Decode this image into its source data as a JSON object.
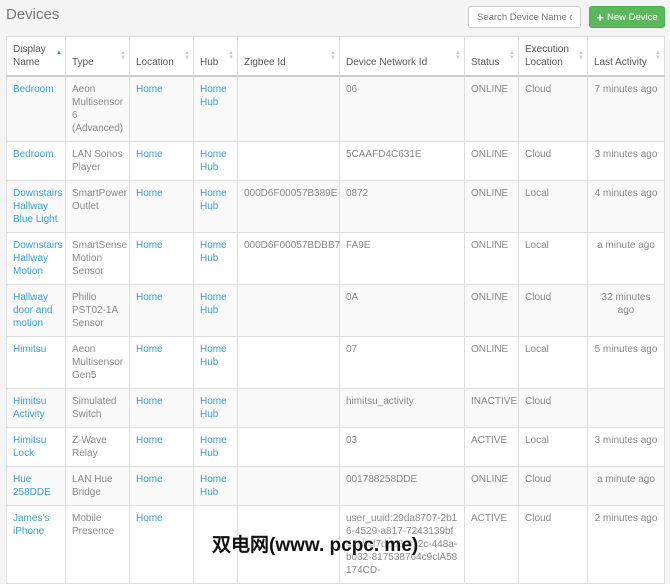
{
  "title": "Devices",
  "search": {
    "placeholder": "Search Device Name or"
  },
  "new_device_label": "New Device",
  "columns": [
    "Display Name",
    "Type",
    "Location",
    "Hub",
    "Zigbee Id",
    "Device Network Id",
    "Status",
    "Execution Location",
    "Last Activity"
  ],
  "rows": [
    [
      "Bedroom",
      "Aeon Multisensor 6 (Advanced)",
      "Home",
      "Home Hub",
      "",
      "06",
      "ONLINE",
      "Cloud",
      "7 minutes ago"
    ],
    [
      "Bedroom",
      "LAN Sonos Player",
      "Home",
      "Home Hub",
      "",
      "5CAAFD4C631E",
      "ONLINE",
      "Cloud",
      "3 minutes ago"
    ],
    [
      "Downstairs Hallway Blue Light",
      "SmartPower Outlet",
      "Home",
      "Home Hub",
      "000D6F00057B389E",
      "0872",
      "ONLINE",
      "Local",
      "4 minutes ago"
    ],
    [
      "Downstairs Hallway Motion",
      "SmartSense Motion Sensor",
      "Home",
      "Home Hub",
      "000D6F00057BDBB7",
      "FA9E",
      "ONLINE",
      "Local",
      "a minute ago"
    ],
    [
      "Hallway door and motion",
      "Philio PST02-1A Sensor",
      "Home",
      "Home Hub",
      "",
      "0A",
      "ONLINE",
      "Cloud",
      "32 minutes ago"
    ],
    [
      "Himitsu",
      "Aeon Multisensor Gen5",
      "Home",
      "Home Hub",
      "",
      "07",
      "ONLINE",
      "Local",
      "5 minutes ago"
    ],
    [
      "Himitsu Activity",
      "Simulated Switch",
      "Home",
      "Home Hub",
      "",
      "himitsu_activity",
      "INACTIVE",
      "Cloud",
      ""
    ],
    [
      "Himitsu Lock",
      "Z-Wave Relay",
      "Home",
      "Home Hub",
      "",
      "03",
      "ACTIVE",
      "Local",
      "3 minutes ago"
    ],
    [
      "Hue 258DDE",
      "LAN Hue Bridge",
      "Home",
      "Home Hub",
      "",
      "001788258DDE",
      "ONLINE",
      "Cloud",
      "a minute ago"
    ],
    [
      "James's iPhone",
      "Mobile Presence",
      "Home",
      "",
      "",
      "user_uuid:29da8707-2b16-4529-a817-7243139bf4aell4f7de63-912c-448a-b032-817538764c9clA58174CD-",
      "ACTIVE",
      "Cloud",
      "2 minutes ago"
    ]
  ],
  "watermark": "双电网(www. pcpc. me)"
}
